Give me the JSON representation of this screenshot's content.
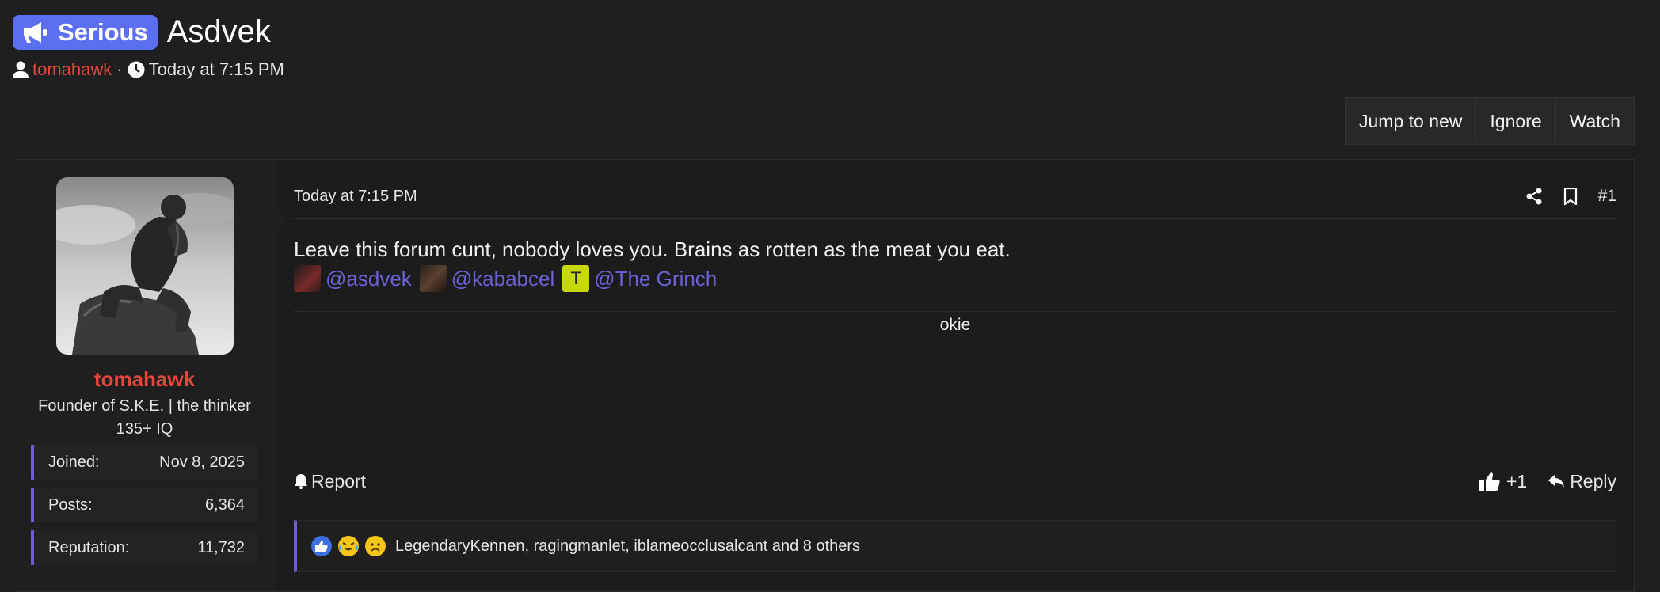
{
  "thread": {
    "prefix": "Serious",
    "title": "Asdvek",
    "author": "tomahawk",
    "separator": "·",
    "date": "Today at 7:15 PM"
  },
  "actions": {
    "jump_label": "Jump to new",
    "ignore_label": "Ignore",
    "watch_label": "Watch"
  },
  "post": {
    "date": "Today at 7:15 PM",
    "number": "#1",
    "body": "Leave this forum cunt, nobody loves you. Brains as rotten as the meat you eat.",
    "mentions": [
      {
        "name": "@asdvek",
        "avatar_color": "#7a2a2a"
      },
      {
        "name": "@kababcel",
        "avatar_color": "#5a4030"
      },
      {
        "name": "@The Grinch",
        "avatar_letter": "T",
        "avatar_color": "#c6d80a"
      }
    ],
    "signature": "okie",
    "report_label": "Report",
    "like_label": "+1",
    "reply_label": "Reply",
    "reactions_text": "LegendaryKennen, ragingmanlet, iblameocclusalcant and 8 others"
  },
  "user": {
    "name": "tomahawk",
    "title_line1": "Founder of S.K.E. | the thinker",
    "title_line2": "135+ IQ",
    "stats": [
      {
        "label": "Joined:",
        "value": "Nov 8, 2025"
      },
      {
        "label": "Posts:",
        "value": "6,364"
      },
      {
        "label": "Reputation:",
        "value": "11,732"
      }
    ]
  },
  "colors": {
    "accent": "#6c5ed8",
    "prefix_bg": "#5b6ff0",
    "username": "#e8453c",
    "mention": "#6a62d6"
  }
}
